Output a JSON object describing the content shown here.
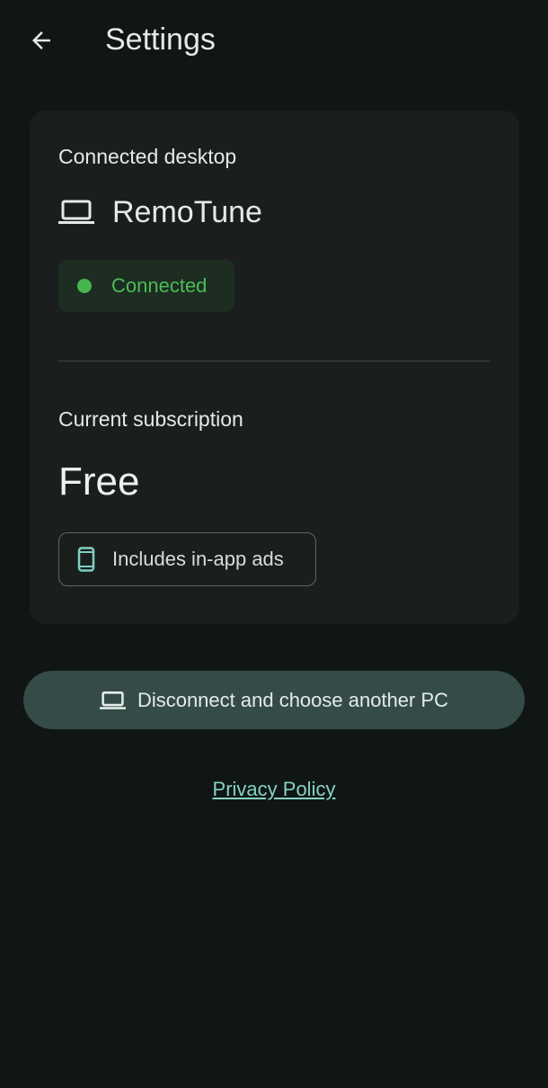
{
  "header": {
    "title": "Settings",
    "back_icon": "arrow-left-icon"
  },
  "device_section": {
    "label": "Connected desktop",
    "device_icon": "laptop-icon",
    "device_name": "RemoTune",
    "status": "Connected",
    "status_color": "#47b54f"
  },
  "subscription_section": {
    "label": "Current subscription",
    "plan": "Free",
    "feature_icon": "phone-icon",
    "feature": "Includes in-app ads"
  },
  "actions": {
    "disconnect_icon": "laptop-icon",
    "disconnect_label": "Disconnect and choose another PC"
  },
  "footer": {
    "privacy_label": "Privacy Policy"
  },
  "colors": {
    "background": "#101614",
    "card": "#1a1f1e",
    "accent_button": "#354b48",
    "link": "#86d2c5"
  }
}
